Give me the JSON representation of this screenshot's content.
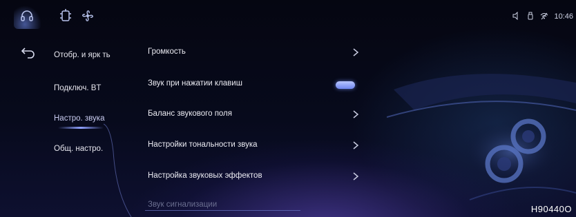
{
  "status_bar": {
    "time": "10:46",
    "icons": [
      "speaker-icon",
      "usb-icon",
      "wifi-off-icon"
    ]
  },
  "top_tabs": [
    "headphones-icon",
    "gearbox-icon",
    "fan-icon"
  ],
  "nav": {
    "items": [
      {
        "label": "Отобр. и ярк ть",
        "active": false
      },
      {
        "label": "Подключ. BT",
        "active": false
      },
      {
        "label": "Настро. звука",
        "active": true
      },
      {
        "label": "Общ. настро.",
        "active": false
      }
    ]
  },
  "settings": [
    {
      "label": "Громкость",
      "control": "chevron"
    },
    {
      "label": "Звук при нажатии клавиш",
      "control": "toggle",
      "value": true
    },
    {
      "label": "Баланс звукового поля",
      "control": "chevron"
    },
    {
      "label": "Настройки тональности звука",
      "control": "chevron"
    },
    {
      "label": "Настройка звуковых эффектов",
      "control": "chevron"
    },
    {
      "label": "Звук сигнализации",
      "control": "none"
    }
  ],
  "watermark": "H90440O",
  "colors": {
    "accent": "#8ea0ff",
    "toggle_on": "#7d92f3"
  }
}
